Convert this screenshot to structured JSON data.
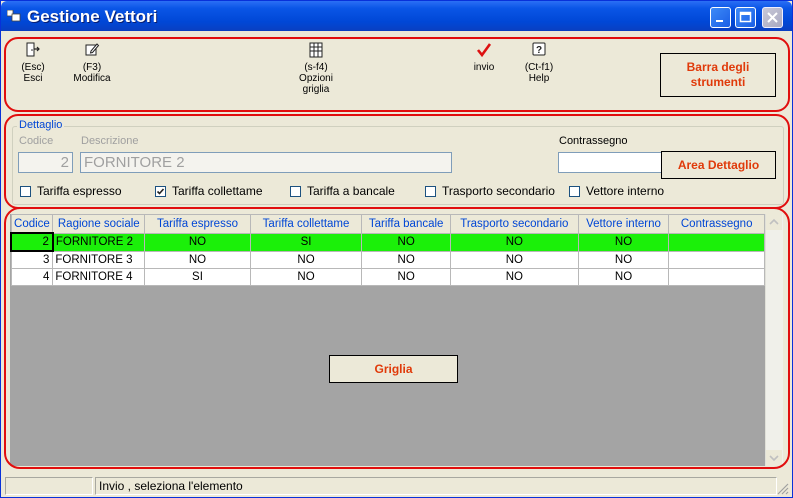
{
  "window": {
    "title": "Gestione Vettori",
    "controls": [
      "minimize-icon",
      "maximize-icon",
      "close-icon"
    ]
  },
  "toolbar": {
    "items": [
      {
        "shortcut": "(Esc)",
        "label": "Esci",
        "icon": "exit-door-icon"
      },
      {
        "shortcut": "(F3)",
        "label": "Modifica",
        "icon": "edit-icon"
      },
      {
        "shortcut": "(s-f4)",
        "label": "Opzioni",
        "label2": "griglia",
        "icon": "grid-options-icon"
      },
      {
        "shortcut": "",
        "label": "invio",
        "icon": "checkmark-icon"
      },
      {
        "shortcut": "(Ct-f1)",
        "label": "Help",
        "icon": "help-icon"
      }
    ],
    "annotation_line1": "Barra degli",
    "annotation_line2": "strumenti"
  },
  "detail": {
    "legend": "Dettaglio",
    "codice_label": "Codice",
    "codice_value": "2",
    "descrizione_label": "Descrizione",
    "descrizione_value": "FORNITORE 2",
    "contrassegno_label": "Contrassegno",
    "contrassegno_value": "",
    "annotation": "Area Dettaglio",
    "checkboxes": [
      {
        "label": "Tariffa espresso",
        "checked": false
      },
      {
        "label": "Tariffa collettame",
        "checked": true
      },
      {
        "label": "Tariffa a bancale",
        "checked": false
      },
      {
        "label": "Trasporto secondario",
        "checked": false
      },
      {
        "label": "Vettore interno",
        "checked": false
      }
    ]
  },
  "grid": {
    "columns": [
      "Codice",
      "Ragione sociale",
      "Tariffa espresso",
      "Tariffa collettame",
      "Tariffa bancale",
      "Trasporto secondario",
      "Vettore interno",
      "Contrassegno"
    ],
    "rows": [
      {
        "c": [
          "2",
          "FORNITORE 2",
          "NO",
          "SI",
          "NO",
          "NO",
          "NO",
          ""
        ]
      },
      {
        "c": [
          "3",
          "FORNITORE 3",
          "NO",
          "NO",
          "NO",
          "NO",
          "NO",
          ""
        ]
      },
      {
        "c": [
          "4",
          "FORNITORE 4",
          "SI",
          "NO",
          "NO",
          "NO",
          "NO",
          ""
        ]
      }
    ],
    "selected_row": 0,
    "annotation": "Griglia"
  },
  "statusbar": {
    "text": "Invio , seleziona l'elemento"
  },
  "colors": {
    "accent_red": "#e10e0e",
    "selection_green": "#1bf009",
    "title_blue": "#0a55e6",
    "header_text_blue": "#0046d5"
  }
}
